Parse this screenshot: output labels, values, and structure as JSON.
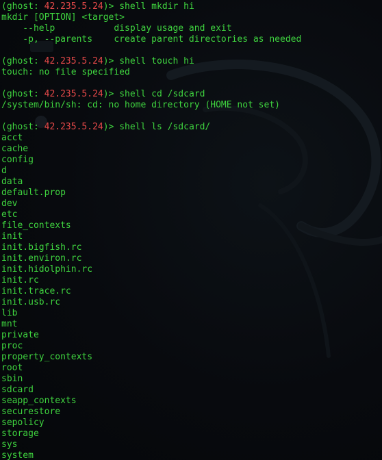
{
  "theme": {
    "text_color": "#3fd43f",
    "ip_color": "#e84a4a",
    "background": "#080a0e"
  },
  "prompt": {
    "prefix": "(ghost: ",
    "ip": "42.235.5.24",
    "suffix": ")> "
  },
  "blocks": [
    {
      "command": "shell mkdir hi",
      "output": [
        "mkdir [OPTION] <target>",
        "    --help           display usage and exit",
        "    -p, --parents    create parent directories as needed"
      ]
    },
    {
      "command": "shell touch hi",
      "output": [
        "touch: no file specified"
      ]
    },
    {
      "command": "shell cd /sdcard",
      "output": [
        "/system/bin/sh: cd: no home directory (HOME not set)"
      ]
    },
    {
      "command": "shell ls /sdcard/",
      "output": [
        "acct",
        "cache",
        "config",
        "d",
        "data",
        "default.prop",
        "dev",
        "etc",
        "file_contexts",
        "init",
        "init.bigfish.rc",
        "init.environ.rc",
        "init.hidolphin.rc",
        "init.rc",
        "init.trace.rc",
        "init.usb.rc",
        "lib",
        "mnt",
        "private",
        "proc",
        "property_contexts",
        "root",
        "sbin",
        "sdcard",
        "seapp_contexts",
        "securestore",
        "sepolicy",
        "storage",
        "sys",
        "system"
      ]
    }
  ]
}
